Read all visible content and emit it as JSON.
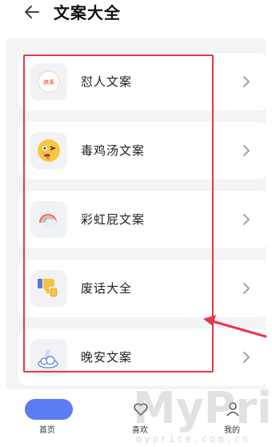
{
  "header": {
    "title": "文案大全",
    "back_icon": "arrow-left-icon"
  },
  "items": [
    {
      "label": "怼人文案",
      "icon": "stamp-icon",
      "icon_text": "搞事"
    },
    {
      "label": "毒鸡汤文案",
      "icon": "dizzy-face-icon"
    },
    {
      "label": "彩虹屁文案",
      "icon": "rainbow-cloud-icon"
    },
    {
      "label": "废话大全",
      "icon": "thumbs-down-icon"
    },
    {
      "label": "晚安文案",
      "icon": "moon-cloud-icon"
    }
  ],
  "tabs": [
    {
      "label": "首页",
      "icon": "home-pill-icon",
      "active": true
    },
    {
      "label": "喜欢",
      "icon": "heart-icon"
    },
    {
      "label": "我的",
      "icon": "user-icon"
    }
  ],
  "watermark": {
    "main": "MyPrice",
    "sub": "myprice.com.cn"
  },
  "colors": {
    "accent": "#5b7cf2",
    "highlight": "#e8394a"
  }
}
